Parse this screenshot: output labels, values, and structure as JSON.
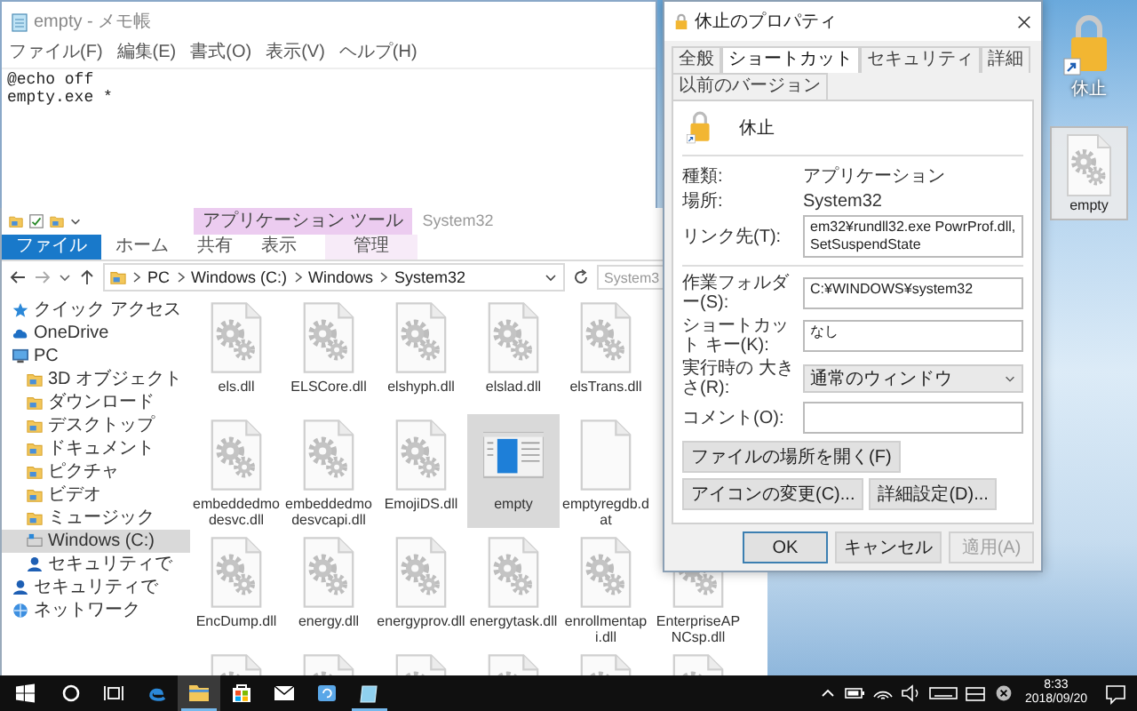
{
  "notepad": {
    "title": "empty - メモ帳",
    "menu": [
      "ファイル(F)",
      "編集(E)",
      "書式(O)",
      "表示(V)",
      "ヘルプ(H)"
    ],
    "lines": [
      "@echo off",
      "empty.exe *"
    ]
  },
  "explorer": {
    "tool_group": "アプリケーション ツール",
    "title": "System32",
    "ribbon_tabs": [
      {
        "label": "ファイル",
        "kind": "file"
      },
      {
        "label": "ホーム",
        "kind": "plain"
      },
      {
        "label": "共有",
        "kind": "plain"
      },
      {
        "label": "表示",
        "kind": "plain"
      },
      {
        "label": "管理",
        "kind": "context"
      }
    ],
    "path": [
      "PC",
      "Windows (C:)",
      "Windows",
      "System32"
    ],
    "search": {
      "placeholder": "System3"
    },
    "sidebar": [
      {
        "label": "クイック アクセス",
        "kind": "star",
        "selected": false
      },
      {
        "label": "OneDrive",
        "kind": "cloud",
        "selected": false
      },
      {
        "label": "PC",
        "kind": "computer",
        "selected": false,
        "children": [
          {
            "label": "3D オブジェクト",
            "kind": "folder",
            "selected": false
          },
          {
            "label": "ダウンロード",
            "kind": "folder",
            "selected": false
          },
          {
            "label": "デスクトップ",
            "kind": "folder",
            "selected": false
          },
          {
            "label": "ドキュメント",
            "kind": "folder",
            "selected": false
          },
          {
            "label": "ピクチャ",
            "kind": "folder",
            "selected": false
          },
          {
            "label": "ビデオ",
            "kind": "folder",
            "selected": false
          },
          {
            "label": "ミュージック",
            "kind": "folder",
            "selected": false
          },
          {
            "label": "Windows (C:)",
            "kind": "drive",
            "selected": true
          },
          {
            "label": "セキュリティで",
            "kind": "user",
            "selected": false
          }
        ]
      },
      {
        "label": "セキュリティで",
        "kind": "user",
        "selected": false
      },
      {
        "label": "ネットワーク",
        "kind": "network",
        "selected": false
      }
    ],
    "file_rows": [
      [
        {
          "name": "els.dll",
          "kind": "dll",
          "selected": false
        },
        {
          "name": "ELSCore.dll",
          "kind": "dll",
          "selected": false
        },
        {
          "name": "elshyph.dll",
          "kind": "dll",
          "selected": false
        },
        {
          "name": "elslad.dll",
          "kind": "dll",
          "selected": false
        },
        {
          "name": "elsTrans.dll",
          "kind": "dll",
          "selected": false
        }
      ],
      [
        {
          "name": "embeddedmodesvc.dll",
          "kind": "dll",
          "selected": false
        },
        {
          "name": "embeddedmodesvcapi.dll",
          "kind": "dll",
          "selected": false
        },
        {
          "name": "EmojiDS.dll",
          "kind": "dll",
          "selected": false
        },
        {
          "name": "empty",
          "kind": "app",
          "selected": true
        },
        {
          "name": "emptyregdb.dat",
          "kind": "blank",
          "selected": false
        }
      ],
      [
        {
          "name": "EncDump.dll",
          "kind": "dll",
          "selected": false
        },
        {
          "name": "energy.dll",
          "kind": "dll",
          "selected": false
        },
        {
          "name": "energyprov.dll",
          "kind": "dll",
          "selected": false
        },
        {
          "name": "energytask.dll",
          "kind": "dll",
          "selected": false
        },
        {
          "name": "enrollmentapi.dll",
          "kind": "dll",
          "selected": false
        },
        {
          "name": "EnterpriseAPNCsp.dll",
          "kind": "dll",
          "selected": false
        }
      ],
      [
        {
          "kind": "dll",
          "selected": false
        },
        {
          "kind": "dll",
          "selected": false
        },
        {
          "kind": "dll",
          "selected": false
        },
        {
          "kind": "dll",
          "selected": false
        },
        {
          "kind": "dll",
          "selected": false
        },
        {
          "kind": "dll",
          "selected": false
        }
      ]
    ]
  },
  "properties": {
    "title": "休止のプロパティ",
    "tabs": [
      {
        "label": "全般",
        "selected": false
      },
      {
        "label": "ショートカット",
        "selected": true
      },
      {
        "label": "セキュリティ",
        "selected": false
      },
      {
        "label": "詳細",
        "selected": false
      },
      {
        "label": "以前のバージョン",
        "selected": false
      }
    ],
    "name": "休止",
    "info": [
      {
        "label": "種類:",
        "value": "アプリケーション"
      },
      {
        "label": "場所:",
        "value": "System32"
      }
    ],
    "link": {
      "label": "リンク先(T):",
      "value": "em32¥rundll32.exe PowrProf.dll,SetSuspendState"
    },
    "fields": [
      {
        "label": "作業フォルダー(S):",
        "value": "C:¥WINDOWS¥system32",
        "kind": "text"
      },
      {
        "label": "ショートカット キー(K):",
        "value": "なし",
        "kind": "text"
      },
      {
        "label": "実行時の 大きさ(R):",
        "value": "通常のウィンドウ",
        "kind": "select"
      },
      {
        "label": "コメント(O):",
        "kind": "text"
      }
    ],
    "actions": [
      "ファイルの場所を開く(F)",
      "アイコンの変更(C)...",
      "詳細設定(D)..."
    ],
    "footer_buttons": [
      {
        "label": "OK",
        "kind": "default",
        "disabled": false
      },
      {
        "label": "キャンセル",
        "kind": "normal",
        "disabled": false
      },
      {
        "label": "適用(A)",
        "kind": "normal",
        "disabled": true
      }
    ]
  },
  "desktop_icons": [
    {
      "label": "休止",
      "kind": "lock",
      "selected": false
    },
    {
      "label": "empty",
      "kind": "dll",
      "selected": true
    }
  ],
  "taskbar": {
    "apps": [
      {
        "kind": "edge",
        "open": false,
        "active": false
      },
      {
        "kind": "explorer",
        "open": true,
        "active": true
      },
      {
        "kind": "store",
        "open": false,
        "active": false
      },
      {
        "kind": "mail",
        "open": false,
        "active": false
      },
      {
        "kind": "sync",
        "open": false,
        "active": false
      },
      {
        "kind": "notepad",
        "open": true,
        "active": false
      }
    ],
    "time": "8:33",
    "date": "2018/09/20"
  }
}
